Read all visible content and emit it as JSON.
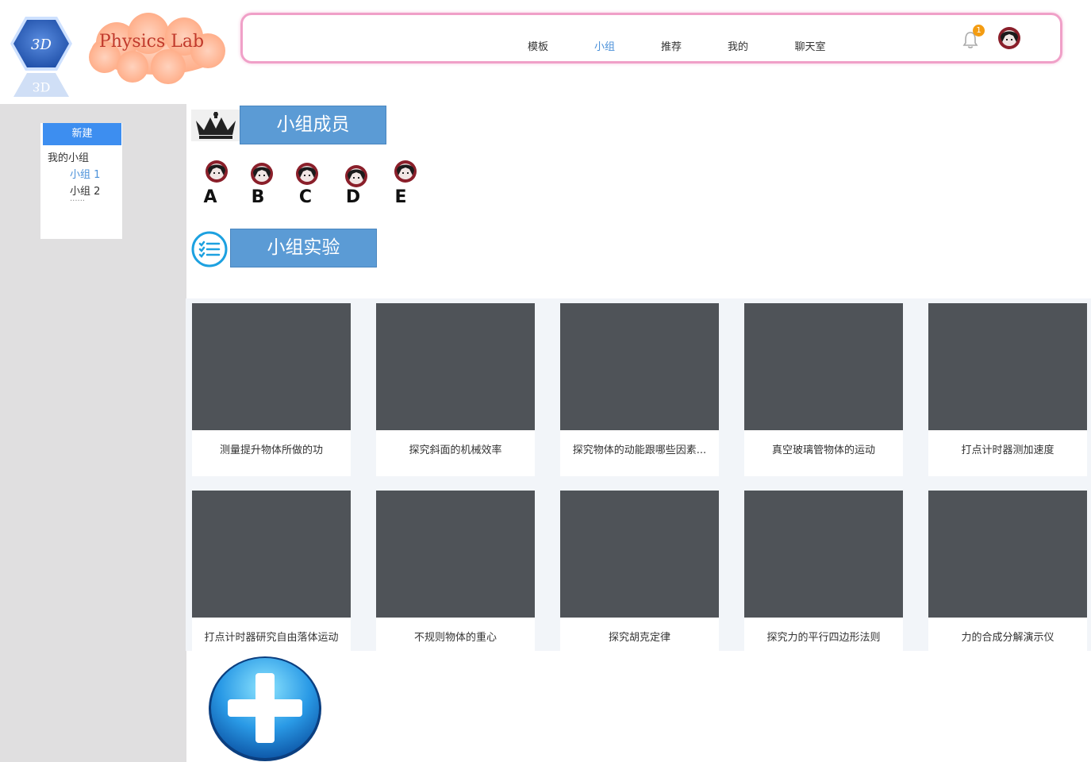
{
  "brand": {
    "logo_text": "3D",
    "name": "Physics Lab"
  },
  "nav": {
    "items": [
      {
        "label": "模板",
        "active": false
      },
      {
        "label": "小组",
        "active": true
      },
      {
        "label": "推荐",
        "active": false
      },
      {
        "label": "我的",
        "active": false
      },
      {
        "label": "聊天室",
        "active": false
      }
    ],
    "notification_count": "1"
  },
  "sidebar": {
    "new_button": "新建",
    "my_groups_label": "我的小组",
    "groups": [
      "小组 1",
      "小组 2"
    ],
    "more": "......"
  },
  "members_section": {
    "title": "小组成员",
    "members": [
      "A",
      "B",
      "C",
      "D",
      "E"
    ]
  },
  "experiments_section": {
    "title": "小组实验",
    "cards": [
      {
        "title": "测量提升物体所做的功"
      },
      {
        "title": "探究斜面的机械效率"
      },
      {
        "title": "探究物体的动能跟哪些因素..."
      },
      {
        "title": "真空玻璃管物体的运动"
      },
      {
        "title": "打点计时器测加速度"
      },
      {
        "title": "打点计时器研究自由落体运动"
      },
      {
        "title": "不规则物体的重心"
      },
      {
        "title": "探究胡克定律"
      },
      {
        "title": "探究力的平行四边形法则"
      },
      {
        "title": "力的合成分解演示仪"
      }
    ]
  },
  "colors": {
    "accent": "#4a90d9",
    "section_box": "#5b9bd5",
    "new_button": "#3d8ef0",
    "card_scene_bg": "#4f5358",
    "nav_border": "#f0a0c8",
    "badge": "#f39c12"
  },
  "icons": [
    "3d-hexagon-logo",
    "cloud-brand-icon",
    "bell-icon",
    "avatar",
    "crown-icon",
    "checklist-icon",
    "add-icon"
  ]
}
